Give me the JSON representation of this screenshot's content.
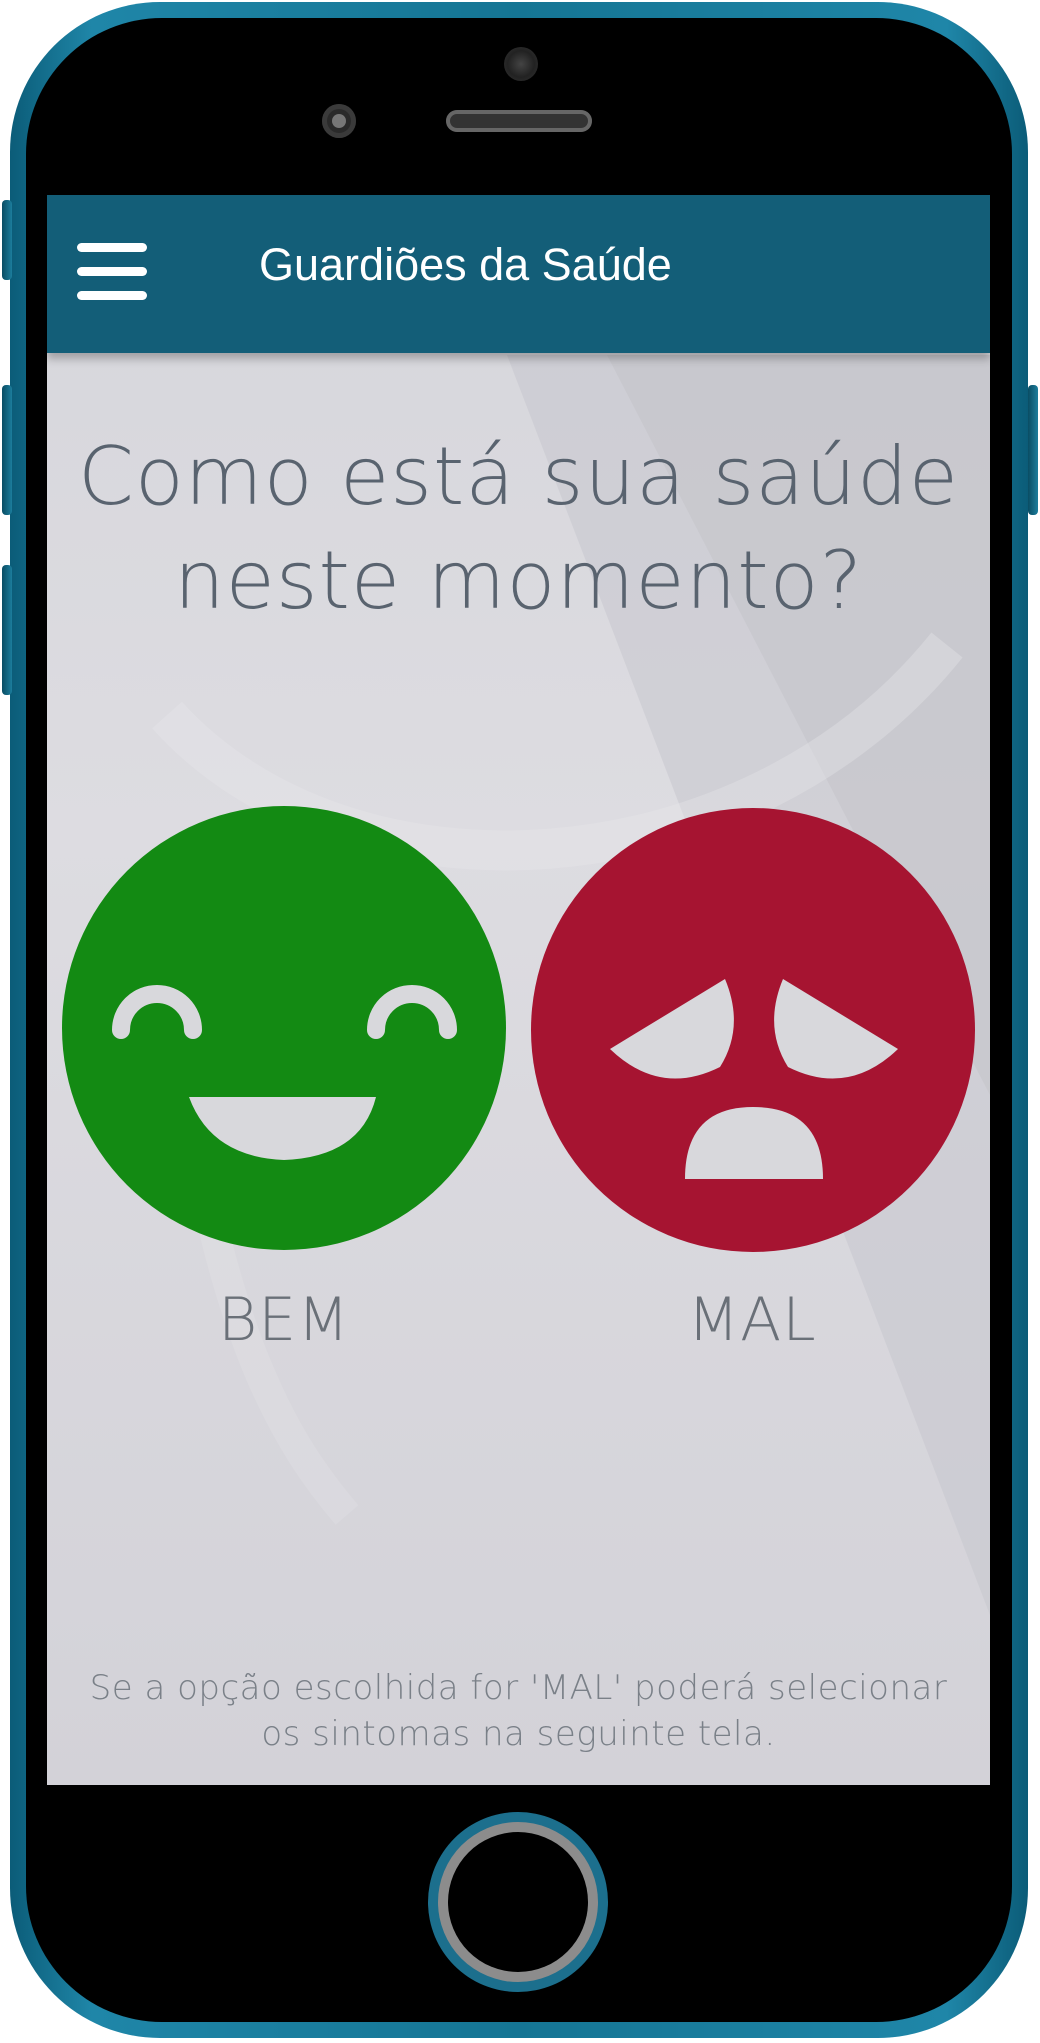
{
  "app_bar": {
    "title": "Guardiões da Saúde",
    "menu_icon": "hamburger-menu-icon",
    "background": "#135e78"
  },
  "question": {
    "line1": "Como está sua saúde",
    "line2": "neste momento?"
  },
  "options": [
    {
      "label": "BEM",
      "icon": "happy-face-icon",
      "color": "#138a13"
    },
    {
      "label": "MAL",
      "icon": "sad-face-icon",
      "color": "#a61431"
    }
  ],
  "hint": {
    "line1": "Se a opção escolhida for 'MAL' poderá selecionar",
    "line2": "os sintomas na seguinte tela."
  },
  "device": {
    "frame_color": "#1b7c9c"
  }
}
